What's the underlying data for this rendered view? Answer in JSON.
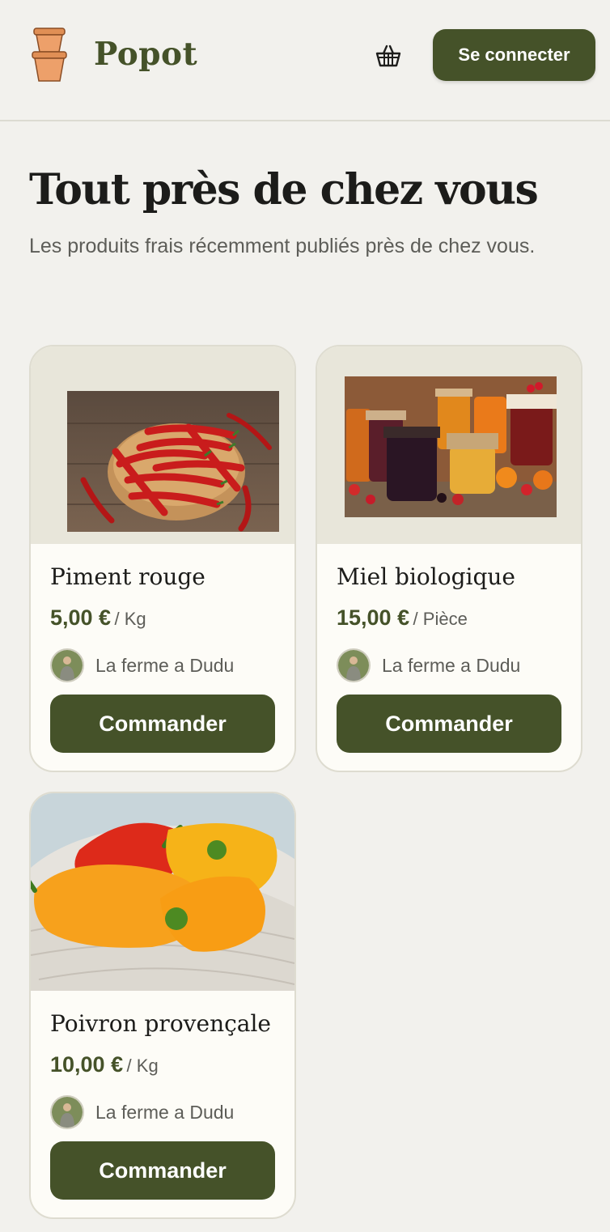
{
  "header": {
    "brand": "Popot",
    "login_label": "Se connecter"
  },
  "icons": {
    "logo": "flowerpot-logo-icon",
    "cart": "basket-icon"
  },
  "hero": {
    "title": "Tout près de chez vous",
    "subtitle": "Les produits frais récemment publiés près de chez vous."
  },
  "colors": {
    "accent": "#455229",
    "background": "#f2f1ed",
    "card_background": "#fdfcf7",
    "image_background": "#e8e6da"
  },
  "products": [
    {
      "name": "Piment rouge",
      "price": "5,00 €",
      "unit": "/ Kg",
      "farm": "La ferme a Dudu",
      "button": "Commander",
      "image": "red-chili-peppers-photo"
    },
    {
      "name": "Miel biologique",
      "price": "15,00 €",
      "unit": "/ Pièce",
      "farm": "La ferme a Dudu",
      "button": "Commander",
      "image": "jam-jars-photo"
    },
    {
      "name": "Poivron provençale",
      "price": "10,00 €",
      "unit": "/ Kg",
      "farm": "La ferme a Dudu",
      "button": "Commander",
      "image": "bell-peppers-photo"
    }
  ]
}
